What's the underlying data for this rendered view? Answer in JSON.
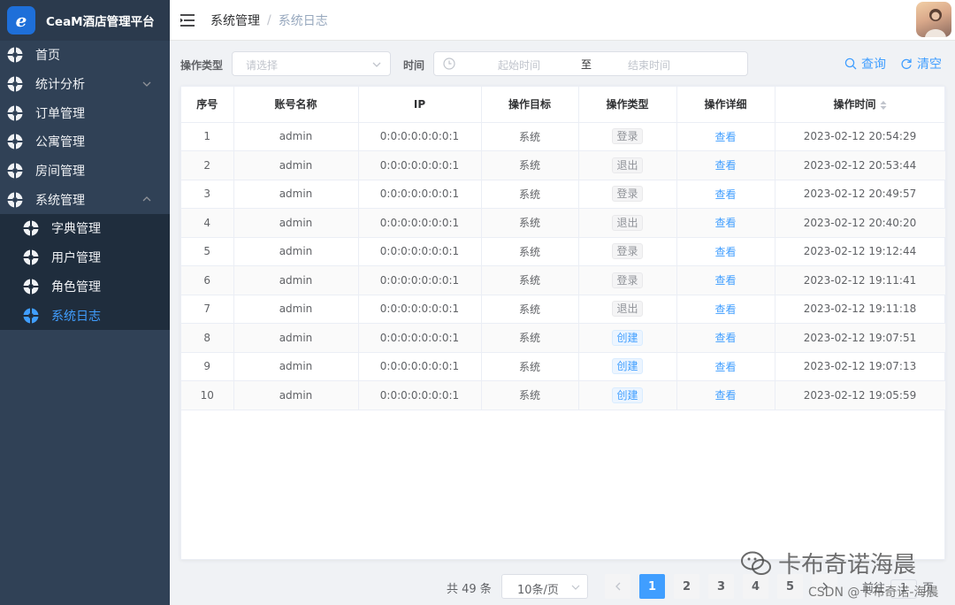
{
  "brand": {
    "logo_letter": "e",
    "title": "CeaM酒店管理平台"
  },
  "sidebar": {
    "items": [
      {
        "label": "首页"
      },
      {
        "label": "统计分析"
      },
      {
        "label": "订单管理"
      },
      {
        "label": "公寓管理"
      },
      {
        "label": "房间管理"
      },
      {
        "label": "系统管理"
      }
    ],
    "submenu": [
      {
        "label": "字典管理"
      },
      {
        "label": "用户管理"
      },
      {
        "label": "角色管理"
      },
      {
        "label": "系统日志"
      }
    ]
  },
  "breadcrumb": {
    "root": "系统管理",
    "sep": "/",
    "current": "系统日志"
  },
  "filters": {
    "op_type_label": "操作类型",
    "op_type_placeholder": "请选择",
    "time_label": "时间",
    "start_placeholder": "起始时间",
    "range_sep": "至",
    "end_placeholder": "结束时间",
    "query_label": "查询",
    "clear_label": "清空"
  },
  "table": {
    "headers": [
      "序号",
      "账号名称",
      "IP",
      "操作目标",
      "操作类型",
      "操作详细",
      "操作时间"
    ],
    "rows": [
      {
        "no": "1",
        "account": "admin",
        "ip": "0:0:0:0:0:0:0:1",
        "target": "系统",
        "op": "登录",
        "detail": "查看",
        "time": "2023-02-12 20:54:29"
      },
      {
        "no": "2",
        "account": "admin",
        "ip": "0:0:0:0:0:0:0:1",
        "target": "系统",
        "op": "退出",
        "detail": "查看",
        "time": "2023-02-12 20:53:44"
      },
      {
        "no": "3",
        "account": "admin",
        "ip": "0:0:0:0:0:0:0:1",
        "target": "系统",
        "op": "登录",
        "detail": "查看",
        "time": "2023-02-12 20:49:57"
      },
      {
        "no": "4",
        "account": "admin",
        "ip": "0:0:0:0:0:0:0:1",
        "target": "系统",
        "op": "退出",
        "detail": "查看",
        "time": "2023-02-12 20:40:20"
      },
      {
        "no": "5",
        "account": "admin",
        "ip": "0:0:0:0:0:0:0:1",
        "target": "系统",
        "op": "登录",
        "detail": "查看",
        "time": "2023-02-12 19:12:44"
      },
      {
        "no": "6",
        "account": "admin",
        "ip": "0:0:0:0:0:0:0:1",
        "target": "系统",
        "op": "登录",
        "detail": "查看",
        "time": "2023-02-12 19:11:41"
      },
      {
        "no": "7",
        "account": "admin",
        "ip": "0:0:0:0:0:0:0:1",
        "target": "系统",
        "op": "退出",
        "detail": "查看",
        "time": "2023-02-12 19:11:18"
      },
      {
        "no": "8",
        "account": "admin",
        "ip": "0:0:0:0:0:0:0:1",
        "target": "系统",
        "op": "创建",
        "detail": "查看",
        "time": "2023-02-12 19:07:51"
      },
      {
        "no": "9",
        "account": "admin",
        "ip": "0:0:0:0:0:0:0:1",
        "target": "系统",
        "op": "创建",
        "detail": "查看",
        "time": "2023-02-12 19:07:13"
      },
      {
        "no": "10",
        "account": "admin",
        "ip": "0:0:0:0:0:0:0:1",
        "target": "系统",
        "op": "创建",
        "detail": "查看",
        "time": "2023-02-12 19:05:59"
      }
    ]
  },
  "pagination": {
    "total": "共 49 条",
    "page_size": "10条/页",
    "pages": [
      "1",
      "2",
      "3",
      "4",
      "5"
    ],
    "current": "1",
    "goto_label": "前往",
    "goto_value": "1",
    "page_unit": "页"
  },
  "watermark": {
    "line1": "卡布奇诺海晨",
    "line2": "CSDN @卡布奇诺-海晨"
  },
  "colors": {
    "sidebar_bg": "#304156",
    "submenu_bg": "#1f2d3d",
    "accent": "#409eff"
  }
}
